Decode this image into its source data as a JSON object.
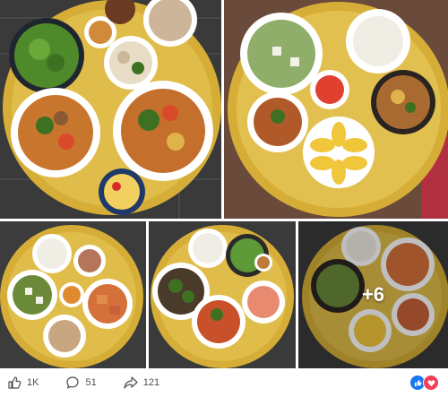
{
  "gallery": {
    "more_label": "+6",
    "colors": {
      "tray": "#d8b13a",
      "table": "#4a4a4a",
      "bowl": "#ffffff",
      "soup": "#c8762e"
    },
    "photos": [
      {
        "name": "photo-1",
        "description_icon": "food-tray-image"
      },
      {
        "name": "photo-2",
        "description_icon": "food-tray-image"
      },
      {
        "name": "photo-3",
        "description_icon": "food-tray-image"
      },
      {
        "name": "photo-4",
        "description_icon": "food-tray-image"
      },
      {
        "name": "photo-5",
        "description_icon": "food-tray-image"
      }
    ]
  },
  "actions": {
    "like_count": "1K",
    "comment_count": "51",
    "share_count": "121"
  },
  "reactions": {
    "like_color": "#1877f2",
    "love_color": "#f33e58"
  }
}
